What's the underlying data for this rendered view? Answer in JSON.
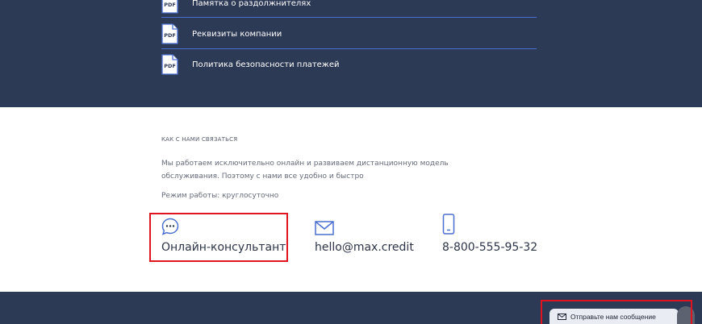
{
  "documents": {
    "items": [
      {
        "icon": "pdf-icon",
        "icon_text": "PDF",
        "label": "Памятка о раздолжнителях"
      },
      {
        "icon": "pdf-icon",
        "icon_text": "PDF",
        "label": "Реквизиты компании"
      },
      {
        "icon": "pdf-icon",
        "icon_text": "PDF",
        "label": "Политика безопасности платежей"
      }
    ]
  },
  "contact": {
    "heading": "КАК С НАМИ СВЯЗАТЬСЯ",
    "description": "Мы работаем исключительно онлайн и развиваем дистанционную модель обслуживания. Поэтому с нами все удобно и быстро",
    "hours": "Режим работы: круглосуточно",
    "online_consultant": {
      "icon": "chat-bubble-icon",
      "label": "Онлайн-консультант"
    },
    "email": {
      "icon": "envelope-icon",
      "label": "hello@max.credit"
    },
    "phone": {
      "icon": "phone-icon",
      "label": "8-800-555-95-32"
    }
  },
  "chat_widget": {
    "icon": "envelope-icon",
    "label": "Отправьте нам сообщение"
  },
  "colors": {
    "navy": "#2d3a55",
    "accent_blue": "#4a6fcf",
    "highlight_red": "#e0141e"
  }
}
